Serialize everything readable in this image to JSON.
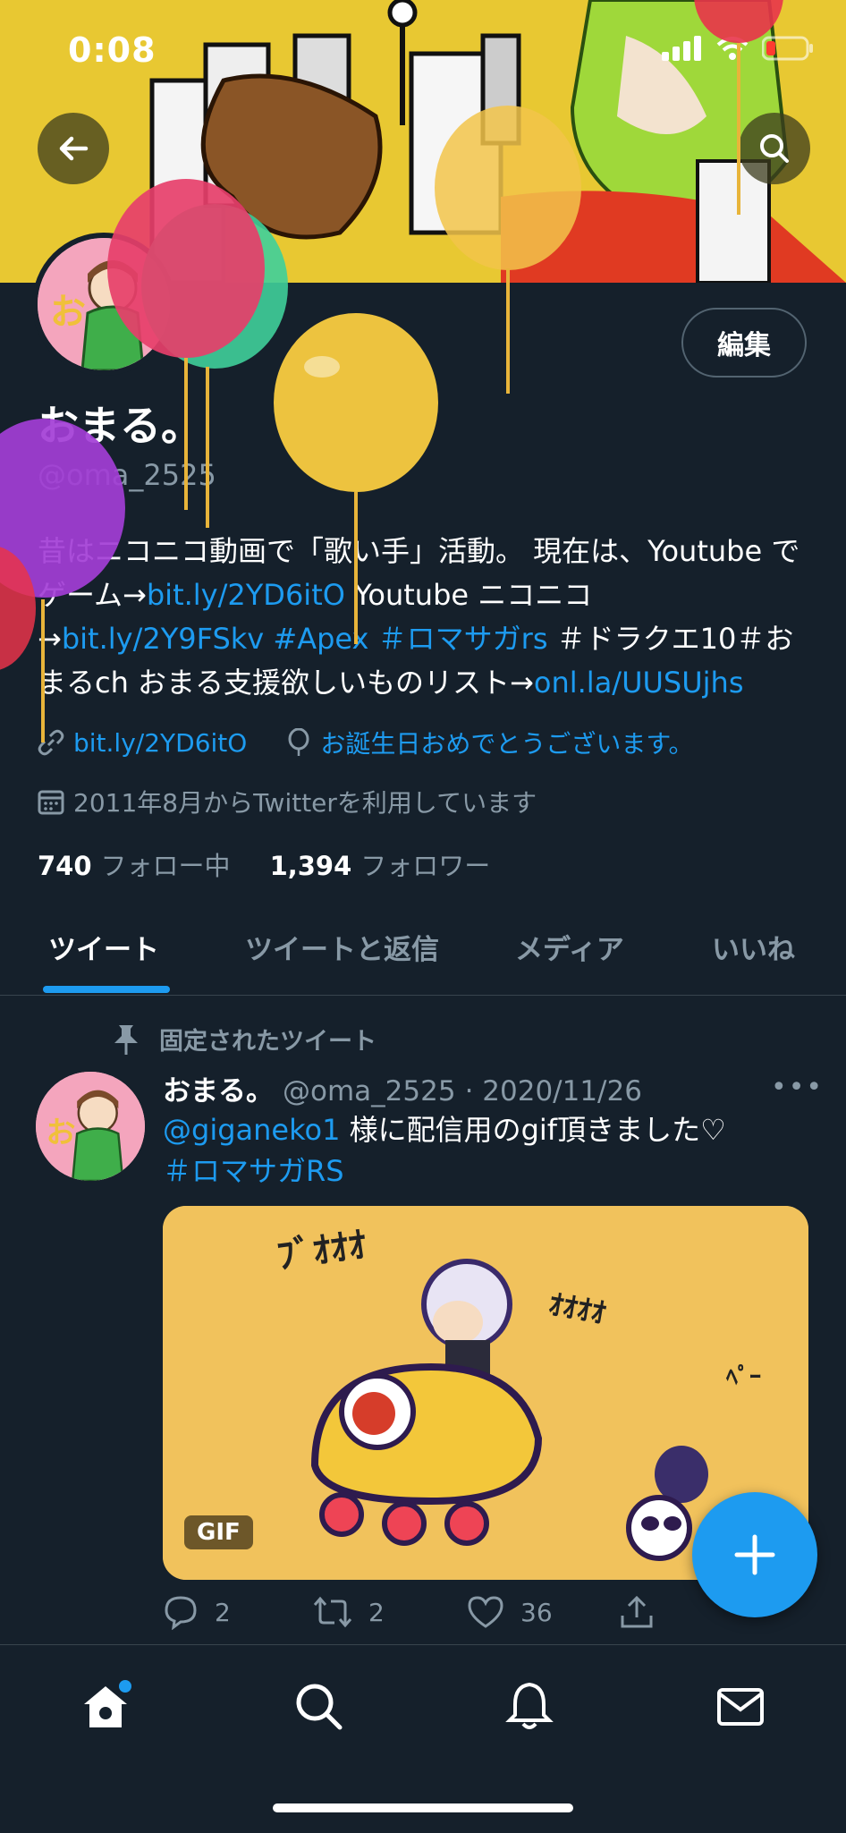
{
  "status_bar": {
    "time": "0:08"
  },
  "profile": {
    "display_name": "おまる。",
    "handle": "@oma_2525",
    "edit_label": "編集",
    "bio": {
      "t1": "昔はニコニコ動画で「歌い手」活動。 現在は、Youtube でゲーム→",
      "l1": "bit.ly/2YD6itO",
      "t2": " Youtube ニコニコ→",
      "l2": "bit.ly/2Y9FSkv",
      "t3": " ",
      "l3": "#Apex",
      "t4": " ",
      "l4": "＃ロマサガrs",
      "t5": " ＃ドラクエ10＃おまるch おまる支援欲しいものリスト→",
      "l5": "onl.la/UUSUjhs"
    },
    "website": "bit.ly/2YD6itO",
    "birthday": "お誕生日おめでとうございます。",
    "joined": "2011年8月からTwitterを利用しています",
    "following_count": "740",
    "following_label": "フォロー中",
    "followers_count": "1,394",
    "followers_label": "フォロワー"
  },
  "tabs": [
    {
      "label": "ツイート"
    },
    {
      "label": "ツイートと返信"
    },
    {
      "label": "メディア"
    },
    {
      "label": "いいね"
    }
  ],
  "tweet": {
    "pinned_label": "固定されたツイート",
    "author_name": "おまる。",
    "author_handle": "@oma_2525",
    "date": "· 2020/11/26",
    "more": "•••",
    "mention": "@giganeko1",
    "text1": " 様に配信用のgif頂きました♡",
    "hashtag": "＃ロマサガRS",
    "media_badge": "GIF",
    "reply_count": "2",
    "retweet_count": "2",
    "like_count": "36"
  },
  "colors": {
    "accent": "#1d9bf0",
    "background": "#15202b",
    "muted": "#8899a6"
  },
  "icons": [
    "back-arrow-icon",
    "search-icon",
    "link-icon",
    "balloon-icon",
    "calendar-icon",
    "pin-icon",
    "reply-icon",
    "retweet-icon",
    "like-icon",
    "share-icon",
    "compose-plus-icon",
    "home-icon",
    "bell-icon",
    "mail-icon"
  ]
}
